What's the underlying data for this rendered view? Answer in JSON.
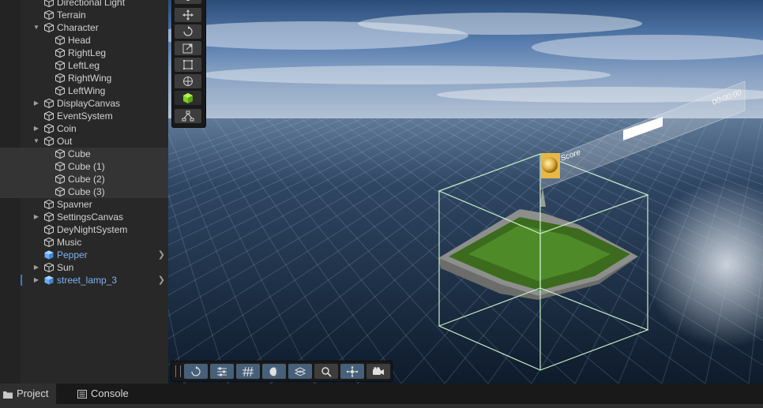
{
  "hierarchy": {
    "items": [
      {
        "label": "Directional Light",
        "depth": 1,
        "arrow": "",
        "prefab": false,
        "more": false
      },
      {
        "label": "Terrain",
        "depth": 1,
        "arrow": "",
        "prefab": false,
        "more": false
      },
      {
        "label": "Character",
        "depth": 1,
        "arrow": "expanded",
        "prefab": false,
        "more": false
      },
      {
        "label": "Head",
        "depth": 2,
        "arrow": "",
        "prefab": false,
        "more": false
      },
      {
        "label": "RightLeg",
        "depth": 2,
        "arrow": "",
        "prefab": false,
        "more": false
      },
      {
        "label": "LeftLeg",
        "depth": 2,
        "arrow": "",
        "prefab": false,
        "more": false
      },
      {
        "label": "RightWing",
        "depth": 2,
        "arrow": "",
        "prefab": false,
        "more": false
      },
      {
        "label": "LeftWing",
        "depth": 2,
        "arrow": "",
        "prefab": false,
        "more": false
      },
      {
        "label": "DisplayCanvas",
        "depth": 1,
        "arrow": "collapsed",
        "prefab": false,
        "more": false
      },
      {
        "label": "EventSystem",
        "depth": 1,
        "arrow": "",
        "prefab": false,
        "more": false
      },
      {
        "label": "Coin",
        "depth": 1,
        "arrow": "collapsed",
        "prefab": false,
        "more": false
      },
      {
        "label": "Out",
        "depth": 1,
        "arrow": "expanded",
        "prefab": false,
        "more": false
      },
      {
        "label": "Cube",
        "depth": 2,
        "arrow": "",
        "prefab": false,
        "more": false,
        "highlight": true
      },
      {
        "label": "Cube (1)",
        "depth": 2,
        "arrow": "",
        "prefab": false,
        "more": false,
        "highlight": true
      },
      {
        "label": "Cube (2)",
        "depth": 2,
        "arrow": "",
        "prefab": false,
        "more": false,
        "highlight": true
      },
      {
        "label": "Cube (3)",
        "depth": 2,
        "arrow": "",
        "prefab": false,
        "more": false,
        "highlight": true
      },
      {
        "label": "Spavner",
        "depth": 1,
        "arrow": "",
        "prefab": false,
        "more": false
      },
      {
        "label": "SettingsCanvas",
        "depth": 1,
        "arrow": "collapsed",
        "prefab": false,
        "more": false
      },
      {
        "label": "DeyNightSystem",
        "depth": 1,
        "arrow": "",
        "prefab": false,
        "more": false
      },
      {
        "label": "Music",
        "depth": 1,
        "arrow": "",
        "prefab": false,
        "more": false
      },
      {
        "label": "Pepper",
        "depth": 1,
        "arrow": "",
        "prefab": true,
        "more": true
      },
      {
        "label": "Sun",
        "depth": 1,
        "arrow": "collapsed",
        "prefab": false,
        "more": false
      },
      {
        "label": "street_lamp_3",
        "depth": 1,
        "arrow": "collapsed",
        "prefab": true,
        "more": true,
        "marked": true
      }
    ]
  },
  "scene": {
    "hud_time": "00:00:00",
    "hud_score_label": "Score"
  },
  "tools": [
    "view-tool",
    "move-tool",
    "rotate-tool",
    "scale-tool",
    "rect-tool",
    "transform-tool",
    "custom-cube-tool",
    "hierarchy-tool"
  ],
  "overlay_toolbar": [
    "refresh",
    "settings",
    "grid",
    "shading",
    "layers",
    "search",
    "pivot",
    "camera"
  ],
  "bottom_tabs": {
    "project_label": "Project",
    "console_label": "Console"
  },
  "colors": {
    "panel": "#282828",
    "prefab_text": "#7fb2f0",
    "selection_marker": "#3a79c9",
    "bounds": "#c8f0c8"
  }
}
